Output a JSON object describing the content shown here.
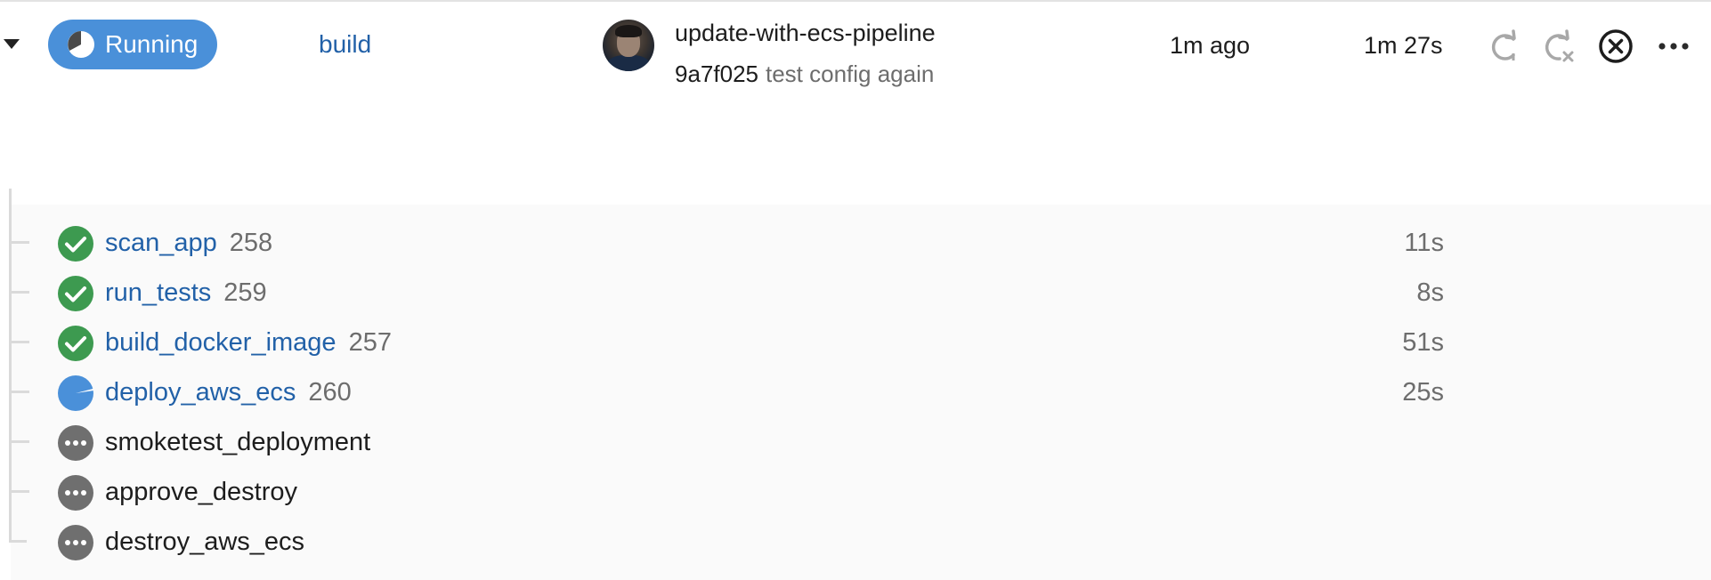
{
  "pipeline": {
    "status": "Running",
    "workflow": "build",
    "branch": "update-with-ecs-pipeline",
    "commit_hash": "9a7f025",
    "commit_message": "test config again",
    "started": "1m ago",
    "duration": "1m 27s",
    "actions": [
      "rerun-icon",
      "rerun-from-failed-icon",
      "cancel-icon",
      "more-icon"
    ]
  },
  "jobs": [
    {
      "name": "scan_app",
      "number": "258",
      "duration": "11s",
      "status": "success"
    },
    {
      "name": "run_tests",
      "number": "259",
      "duration": "8s",
      "status": "success"
    },
    {
      "name": "build_docker_image",
      "number": "257",
      "duration": "51s",
      "status": "success"
    },
    {
      "name": "deploy_aws_ecs",
      "number": "260",
      "duration": "25s",
      "status": "running"
    },
    {
      "name": "smoketest_deployment",
      "number": "",
      "duration": "",
      "status": "queued"
    },
    {
      "name": "approve_destroy",
      "number": "",
      "duration": "",
      "status": "queued"
    },
    {
      "name": "destroy_aws_ecs",
      "number": "",
      "duration": "",
      "status": "queued"
    }
  ],
  "colors": {
    "running": "#4a90d9",
    "success": "#3d9a50",
    "queued": "#6f6f6f",
    "link": "#2261a8"
  }
}
